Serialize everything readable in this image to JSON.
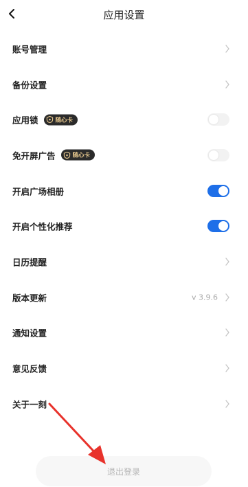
{
  "header": {
    "title": "应用设置",
    "back_icon": "chevron-left-icon"
  },
  "settings": [
    {
      "label": "账号管理",
      "control": "chevron"
    },
    {
      "label": "备份设置",
      "control": "chevron"
    },
    {
      "label": "应用锁",
      "badge": "随心卡",
      "control": "toggle",
      "on": false
    },
    {
      "label": "免开屏广告",
      "badge": "随心卡",
      "control": "toggle",
      "on": false
    },
    {
      "label": "开启广场相册",
      "control": "toggle",
      "on": true
    },
    {
      "label": "开启个性化推荐",
      "control": "toggle",
      "on": true
    },
    {
      "label": "日历提醒",
      "control": "chevron"
    },
    {
      "label": "版本更新",
      "value": "v 3.9.6",
      "control": "chevron"
    },
    {
      "label": "通知设置",
      "control": "chevron"
    },
    {
      "label": "意见反馈",
      "control": "chevron"
    },
    {
      "label": "关于一刻",
      "control": "chevron"
    }
  ],
  "logout": {
    "label": "退出登录"
  },
  "colors": {
    "toggle_on": "#1e6fe8",
    "toggle_off": "#f2f2f2",
    "badge_bg": "#2b2b2b",
    "badge_text": "#e8c98f",
    "annotation_arrow": "#e8322b"
  }
}
